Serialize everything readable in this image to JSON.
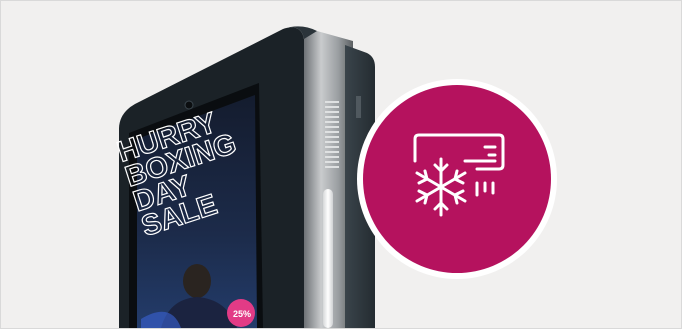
{
  "screen": {
    "headline_lines": [
      "HURRY",
      "BOXING",
      "DAY",
      "SALE"
    ],
    "badge_text": "25%"
  },
  "feature_icon": {
    "name": "air-conditioner-snowflake-icon",
    "color": "#b5125e"
  },
  "colors": {
    "background": "#f1f0ef",
    "kiosk_body": "#1f272c",
    "screen_bezel": "#0a0d10",
    "accent": "#b5125e"
  }
}
